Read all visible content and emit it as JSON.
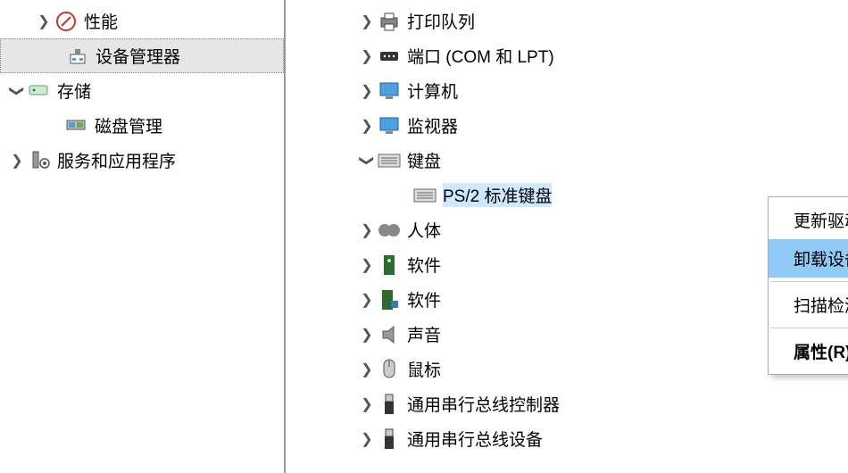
{
  "left": {
    "performance": "性能",
    "device_manager": "设备管理器",
    "storage": "存储",
    "disk_management": "磁盘管理",
    "services_apps": "服务和应用程序"
  },
  "right": {
    "print_queue": "打印队列",
    "ports": "端口 (COM 和 LPT)",
    "computer": "计算机",
    "monitor": "监视器",
    "keyboard": "键盘",
    "ps2_keyboard": "PS/2 标准键盘",
    "hid_partial": "人体",
    "software1_partial": "软件",
    "software2_partial": "软件",
    "sound_partial": "声音",
    "mouse_partial": "鼠标",
    "usb_controllers": "通用串行总线控制器",
    "usb_devices": "通用串行总线设备"
  },
  "menu": {
    "update_driver": "更新驱动程序(P)",
    "uninstall_device": "卸载设备(U)",
    "scan_hardware": "扫描检测硬件改动(A)",
    "properties": "属性(R)"
  }
}
